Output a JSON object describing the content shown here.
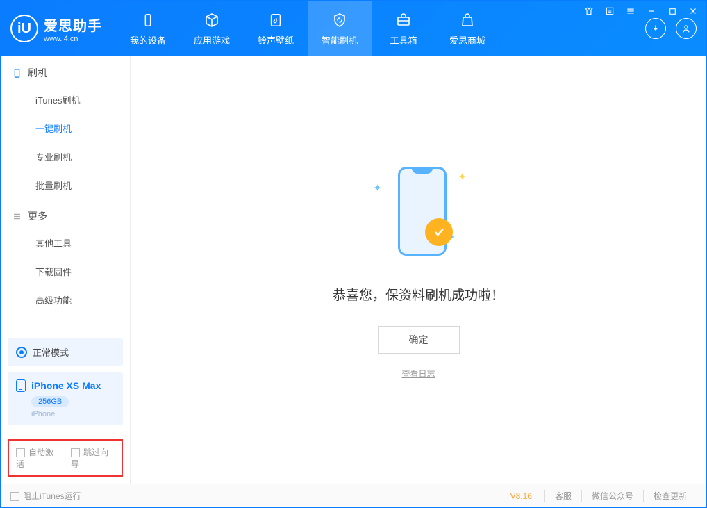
{
  "app": {
    "name": "爱思助手",
    "site": "www.i4.cn"
  },
  "nav": {
    "items": [
      {
        "label": "我的设备"
      },
      {
        "label": "应用游戏"
      },
      {
        "label": "铃声壁纸"
      },
      {
        "label": "智能刷机"
      },
      {
        "label": "工具箱"
      },
      {
        "label": "爱思商城"
      }
    ]
  },
  "sidebar": {
    "section1": {
      "title": "刷机",
      "items": [
        "iTunes刷机",
        "一键刷机",
        "专业刷机",
        "批量刷机"
      ]
    },
    "section2": {
      "title": "更多",
      "items": [
        "其他工具",
        "下载固件",
        "高级功能"
      ]
    },
    "mode": "正常模式",
    "device": {
      "name": "iPhone XS Max",
      "capacity": "256GB",
      "type": "iPhone"
    },
    "checks": {
      "auto_activate": "自动激活",
      "skip_guide": "跳过向导"
    }
  },
  "main": {
    "success_msg": "恭喜您，保资料刷机成功啦！",
    "ok": "确定",
    "view_log": "查看日志"
  },
  "footer": {
    "block_itunes": "阻止iTunes运行",
    "version": "V8.16",
    "links": [
      "客服",
      "微信公众号",
      "检查更新"
    ]
  }
}
